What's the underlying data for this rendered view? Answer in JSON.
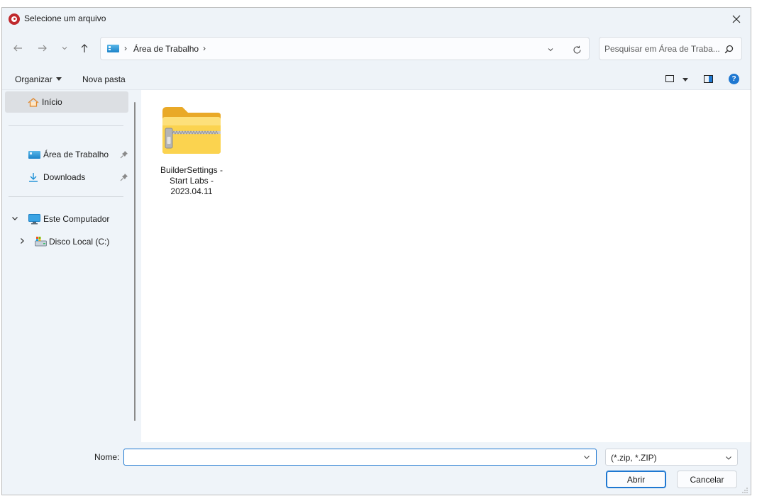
{
  "window": {
    "title": "Selecione um arquivo",
    "app_icon": "app-logo-icon",
    "close_glyph": "✕"
  },
  "navigation": {
    "back_icon": "arrow-left-icon",
    "forward_icon": "arrow-right-icon",
    "recent_icon": "chevron-down-icon",
    "up_icon": "arrow-up-icon",
    "address": {
      "location_icon": "desktop-icon",
      "separator": "›",
      "location": "Área de Trabalho"
    },
    "refresh_icon": "refresh-icon",
    "search": {
      "placeholder": "Pesquisar em Área de Traba...",
      "icon": "search-icon"
    }
  },
  "commands": {
    "organize": "Organizar",
    "new_folder": "Nova pasta",
    "view_icon": "view-icon",
    "preview_pane_icon": "preview-pane-icon",
    "help_glyph": "?"
  },
  "sidebar": {
    "home": "Início",
    "quick_access": [
      {
        "label": "Área de Trabalho",
        "icon": "desktop-icon",
        "pinned": true
      },
      {
        "label": "Downloads",
        "icon": "download-icon",
        "pinned": true
      }
    ],
    "this_pc": {
      "label": "Este Computador",
      "icon": "computer-icon",
      "expanded": true
    },
    "drives": [
      {
        "label": "Disco Local (C:)",
        "icon": "drive-icon",
        "expanded": false
      }
    ]
  },
  "files": [
    {
      "name": "BuilderSettings - Start Labs - 2023.04.11",
      "icon": "zip-folder-icon"
    }
  ],
  "footer": {
    "name_label": "Nome:",
    "name_value": "",
    "file_type": "(*.zip, *.ZIP)",
    "open_button": "Abrir",
    "cancel_button": "Cancelar"
  },
  "colors": {
    "accent": "#1f78d1",
    "folder_yellow": "#f7c64a",
    "chrome_background": "#eff4f9",
    "selected_item": "#dcdfe3"
  }
}
